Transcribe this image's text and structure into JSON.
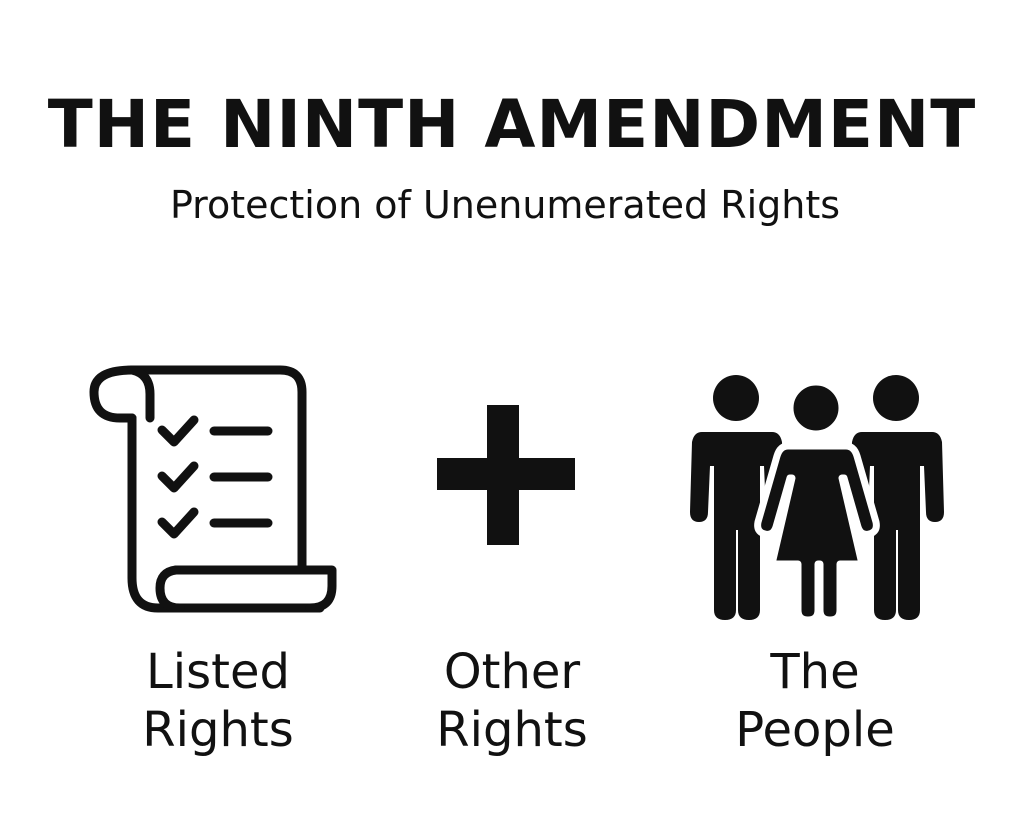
{
  "title": "THE NINTH AMENDMENT",
  "subtitle": "Protection of Unenumerated Rights",
  "items": [
    {
      "line1": "Listed",
      "line2": "Rights",
      "icon": "scroll-checklist-icon"
    },
    {
      "line1": "Other",
      "line2": "Rights",
      "icon": "plus-icon"
    },
    {
      "line1": "The",
      "line2": "People",
      "icon": "people-group-icon"
    }
  ]
}
